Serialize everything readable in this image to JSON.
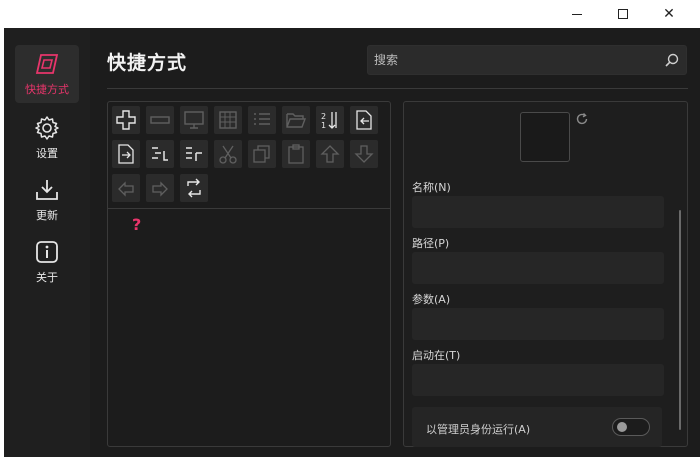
{
  "window_controls": {
    "minimize": "minimize",
    "maximize": "maximize",
    "close": "✕"
  },
  "sidebar": {
    "items": [
      {
        "label": "快捷方式",
        "icon": "shortcut-icon",
        "active": true
      },
      {
        "label": "设置",
        "icon": "gear-icon",
        "active": false
      },
      {
        "label": "更新",
        "icon": "download-icon",
        "active": false
      },
      {
        "label": "关于",
        "icon": "info-icon",
        "active": false
      }
    ]
  },
  "header": {
    "title": "快捷方式",
    "search": {
      "placeholder": "搜索",
      "value": ""
    }
  },
  "toolbar": {
    "buttons": [
      {
        "icon": "add-icon",
        "enabled": true
      },
      {
        "icon": "remove-icon",
        "enabled": false
      },
      {
        "icon": "monitor-icon",
        "enabled": false
      },
      {
        "icon": "grid-icon",
        "enabled": false
      },
      {
        "icon": "list-icon",
        "enabled": false
      },
      {
        "icon": "folder-open-icon",
        "enabled": false
      },
      {
        "icon": "sort-icon",
        "enabled": true
      },
      {
        "icon": "import-icon",
        "enabled": true
      },
      {
        "icon": "export-icon",
        "enabled": true
      },
      {
        "icon": "indent-in-icon",
        "enabled": true
      },
      {
        "icon": "indent-out-icon",
        "enabled": true
      },
      {
        "icon": "cut-icon",
        "enabled": false
      },
      {
        "icon": "copy-icon",
        "enabled": false
      },
      {
        "icon": "paste-icon",
        "enabled": false
      },
      {
        "icon": "move-up-icon",
        "enabled": false
      },
      {
        "icon": "move-down-icon",
        "enabled": false
      },
      {
        "icon": "undo-icon",
        "enabled": false
      },
      {
        "icon": "redo-icon",
        "enabled": false
      },
      {
        "icon": "refresh-list-icon",
        "enabled": true
      }
    ]
  },
  "list": {
    "marker": "?"
  },
  "properties": {
    "name_label": "名称(N)",
    "path_label": "路径(P)",
    "args_label": "参数(A)",
    "start_in_label": "启动在(T)",
    "run_as_admin_label": "以管理员身份运行(A)",
    "run_as_admin": false
  },
  "colors": {
    "accent": "#e8356b",
    "background": "#1c1c1c",
    "sidebar": "#1f1f1f"
  }
}
